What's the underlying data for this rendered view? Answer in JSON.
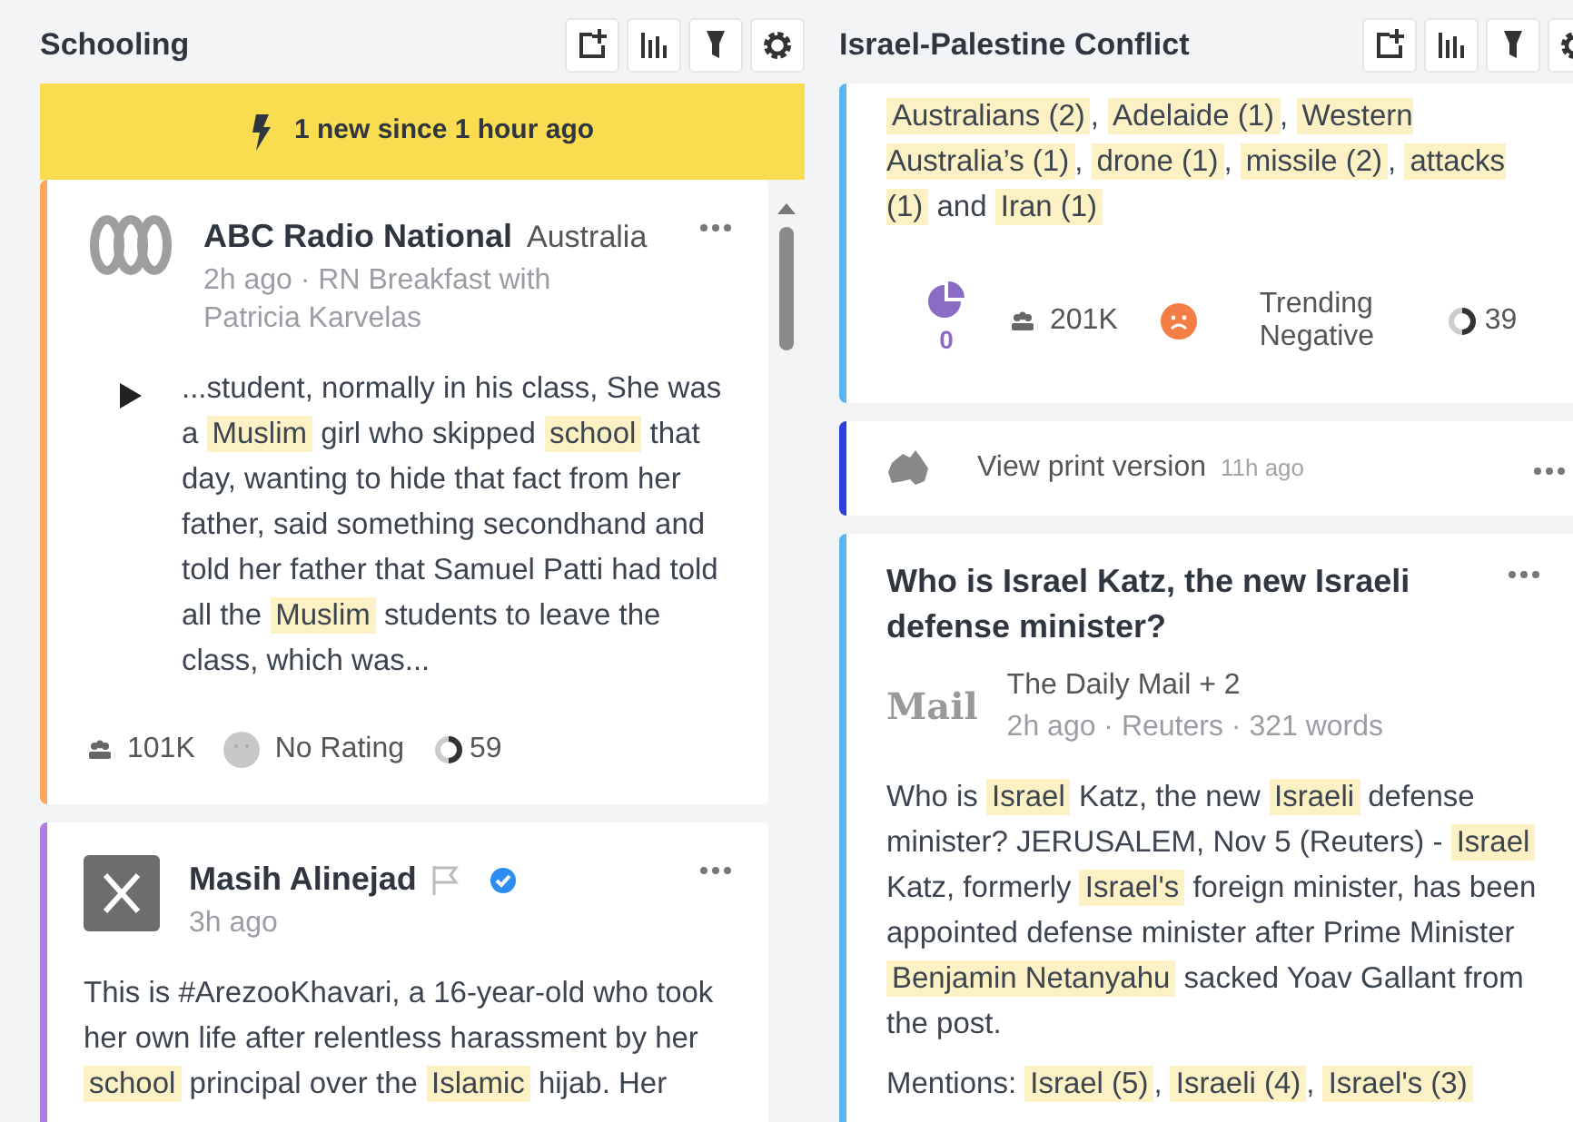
{
  "columns": [
    {
      "title": "Schooling",
      "banner": "1 new since 1 hour ago",
      "scrollbar": true,
      "items": [
        {
          "kind": "article",
          "color": "#ffa65a",
          "source": "ABC Radio National",
          "region": "Australia",
          "meta": "2h ago · RN Breakfast with Patricia Karvelas",
          "play": true,
          "body": [
            {
              "t": "...student, normally in his class, She was a ",
              "hl": false
            },
            {
              "t": "Muslim",
              "hl": true
            },
            {
              "t": " girl who skipped ",
              "hl": false
            },
            {
              "t": "school",
              "hl": true
            },
            {
              "t": " that day, wanting to hide that fact from her father, said something secondhand and told her father that Samuel Patti had told all the ",
              "hl": false
            },
            {
              "t": "Muslim",
              "hl": true
            },
            {
              "t": " students to leave the class, which was...",
              "hl": false
            }
          ],
          "stats": {
            "reach": "101K",
            "rating": "No Rating",
            "score": "59"
          }
        },
        {
          "kind": "tweet",
          "color": "#b07be0",
          "source": "Masih Alinejad",
          "verified": true,
          "meta": "3h ago",
          "body": [
            {
              "t": "This is #ArezooKhavari, a 16-year-old who took her own life after relentless harassment by her ",
              "hl": false
            },
            {
              "t": "school",
              "hl": true
            },
            {
              "t": " principal over the ",
              "hl": false
            },
            {
              "t": "Islamic",
              "hl": true
            },
            {
              "t": " hijab. Her",
              "hl": false
            }
          ]
        }
      ]
    },
    {
      "title": "Israel-Palestine Conflict",
      "scrollbar": false,
      "items": [
        {
          "kind": "mentions",
          "color": "#5bb5f5",
          "body": [
            {
              "t": "Australians (2)",
              "hl": true
            },
            {
              "t": ", ",
              "hl": false
            },
            {
              "t": "Adelaide (1)",
              "hl": true
            },
            {
              "t": ", ",
              "hl": false
            },
            {
              "t": "Western Australia’s (1)",
              "hl": true
            },
            {
              "t": ", ",
              "hl": false
            },
            {
              "t": "drone (1)",
              "hl": true
            },
            {
              "t": ", ",
              "hl": false
            },
            {
              "t": "missile (2)",
              "hl": true
            },
            {
              "t": ", ",
              "hl": false
            },
            {
              "t": "attacks (1)",
              "hl": true
            },
            {
              "t": " and ",
              "hl": false
            },
            {
              "t": "Iran (1)",
              "hl": true
            }
          ],
          "stats": {
            "count": "0",
            "reach": "201K",
            "sentiment": "Trending Negative",
            "score": "39"
          }
        },
        {
          "kind": "print",
          "color": "#2b3ee0",
          "label": "View print version",
          "time": "11h ago"
        },
        {
          "kind": "story",
          "color": "#5bb5f5",
          "headline": "Who is Israel Katz, the new Israeli defense minister?",
          "logo_text": "Mail",
          "source": "The Daily Mail + 2",
          "meta": "2h ago · Reuters  · 321 words",
          "body": [
            {
              "t": "Who is ",
              "hl": false
            },
            {
              "t": "Israel",
              "hl": true
            },
            {
              "t": " Katz, the new ",
              "hl": false
            },
            {
              "t": "Israeli",
              "hl": true
            },
            {
              "t": " defense minister? JERUSALEM, Nov 5 (Reuters) - ",
              "hl": false
            },
            {
              "t": "Israel",
              "hl": true
            },
            {
              "t": " Katz, formerly ",
              "hl": false
            },
            {
              "t": "Israel's",
              "hl": true
            },
            {
              "t": " foreign minister, has been appointed defense minister after Prime Minister ",
              "hl": false
            },
            {
              "t": "Benjamin Netanyahu",
              "hl": true
            },
            {
              "t": " sacked Yoav Gallant from the post.",
              "hl": false
            }
          ],
          "mentions": [
            {
              "t": "Mentions: ",
              "hl": false
            },
            {
              "t": "Israel (5)",
              "hl": true
            },
            {
              "t": ", ",
              "hl": false
            },
            {
              "t": "Israeli (4)",
              "hl": true
            },
            {
              "t": ", ",
              "hl": false
            },
            {
              "t": "Israel's (3)",
              "hl": true
            }
          ]
        }
      ]
    }
  ]
}
